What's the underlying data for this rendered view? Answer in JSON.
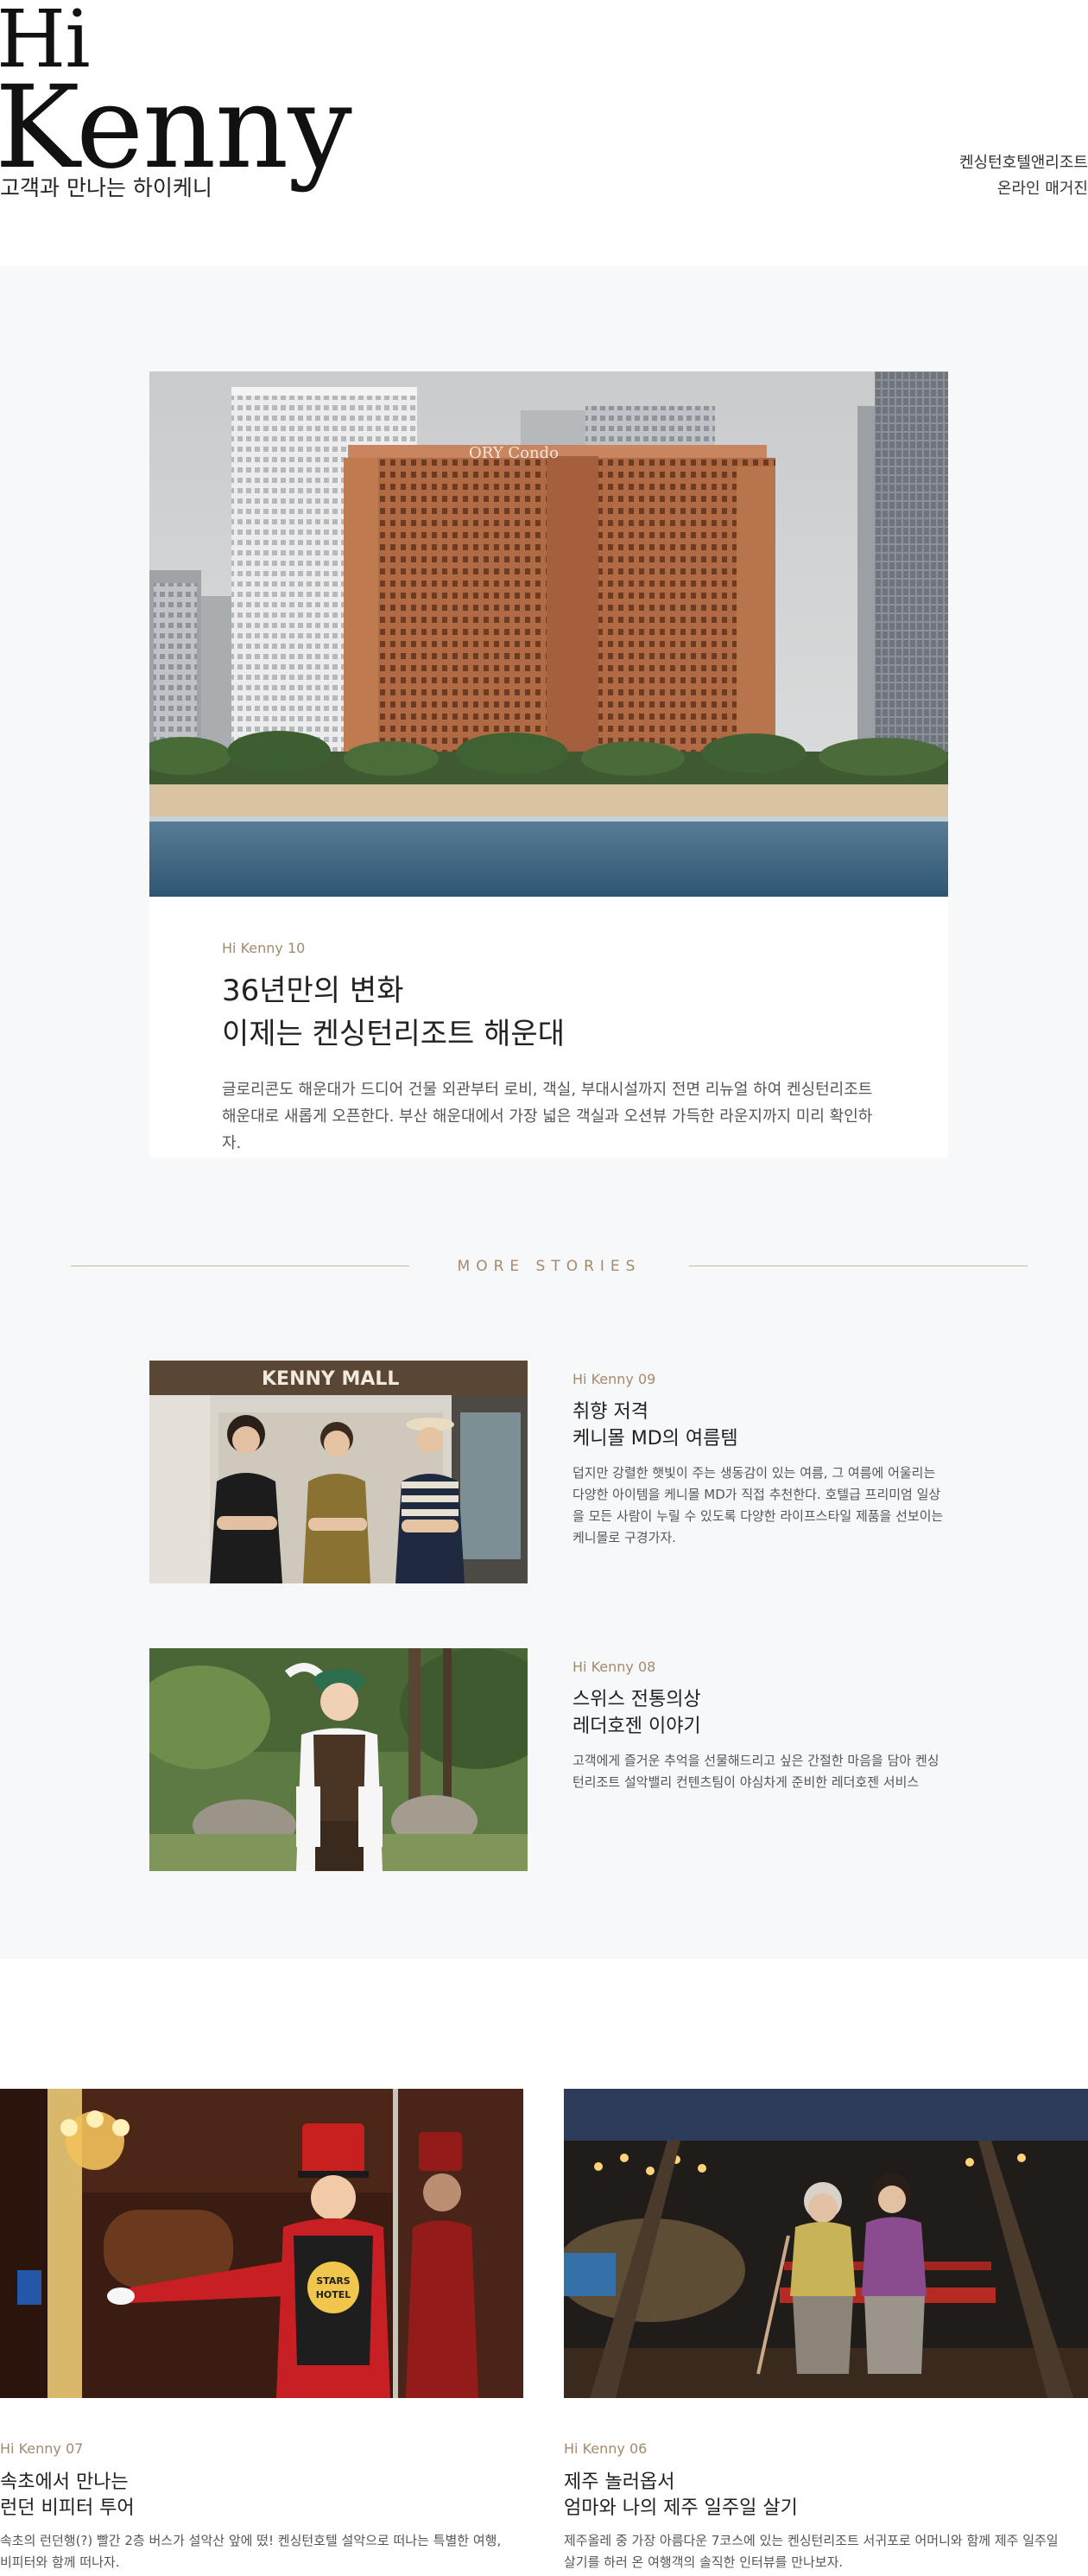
{
  "header": {
    "title_line1": "Hi",
    "title_line2": "Kenny",
    "subtitle": "고객과 만나는 하이케니",
    "tagline_line1": "켄싱턴호텔앤리조트",
    "tagline_line2": "온라인 매거진"
  },
  "featured": {
    "eyebrow": "Hi Kenny 10",
    "headline_line1": "36년만의 변화",
    "headline_line2": "이제는 켄싱턴리조트 해운대",
    "body": "글로리콘도 해운대가 드디어 건물 외관부터 로비, 객실, 부대시설까지 전면 리뉴얼 하여 켄싱턴리조트 해운대로 새롭게 오픈한다. 부산 해운대에서 가장 넓은 객실과 오션뷰 가득한 라운지까지 미리 확인하자.",
    "image_sign_text": "ORY Condo"
  },
  "more_stories": {
    "label": "MORE STORIES"
  },
  "stories": [
    {
      "eyebrow": "Hi Kenny 09",
      "headline_line1": "취향 저격",
      "headline_line2": "케니몰 MD의 여름템",
      "body": "덥지만 강렬한 햇빛이 주는 생동감이 있는 여름, 그 여름에 어울리는 다양한 아이템을 케니몰 MD가 직접 추천한다. 호텔급 프리미엄 일상을 모든 사람이 누릴 수 있도록 다양한 라이프스타일 제품을 선보이는 케니몰로 구경가자.",
      "image_sign_text": "KENNY MALL"
    },
    {
      "eyebrow": "Hi Kenny 08",
      "headline_line1": "스위스 전통의상",
      "headline_line2": "레더호젠 이야기",
      "body": "고객에게 즐거운 추억을 선물해드리고 싶은 간절한 마음을 담아 켄싱턴리조트 설악밸리 컨텐츠팀이 야심차게 준비한 레더호젠 서비스"
    }
  ],
  "cards": [
    {
      "eyebrow": "Hi Kenny 07",
      "headline_line1": "속초에서 만나는",
      "headline_line2": "런던 비피터 투어",
      "body_line1": "속초의 런던행(?) 빨간 2층 버스가 설악산 앞에 떴! 켄싱턴호텔 설악으로 떠나는 특별한 여행,",
      "body_line2": "비피터와 함께 떠나자.",
      "image_badge_line1": "STARS",
      "image_badge_line2": "HOTEL"
    },
    {
      "eyebrow": "Hi Kenny 06",
      "headline_line1": "제주 놀러옵서",
      "headline_line2": "엄마와 나의 제주 일주일 살기",
      "body_line1": "제주올레 중 가장 아름다운 7코스에 있는 켄싱턴리조트 서귀포로 어머니와 함께 제주 일주일",
      "body_line2": "살기를 하러 온 여행객의 솔직한 인터뷰를 만나보자."
    }
  ],
  "colors": {
    "accent": "#a48a6c",
    "band_background": "#f7f8fa",
    "divider_rule": "#c8b99e"
  }
}
